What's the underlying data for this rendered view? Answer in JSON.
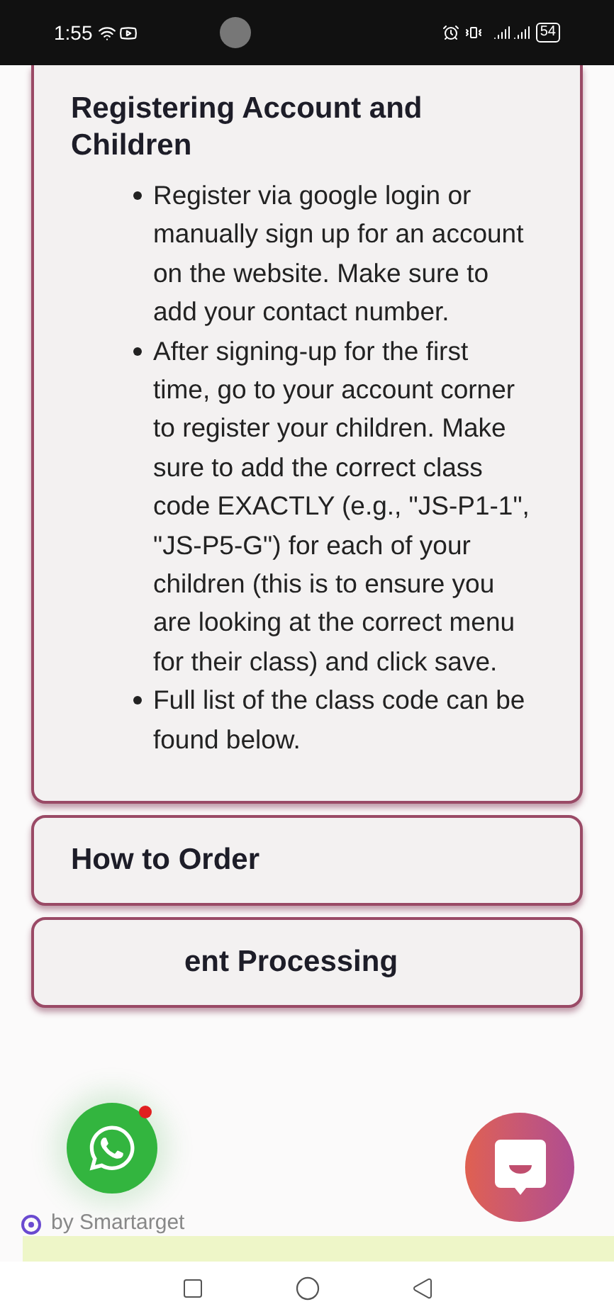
{
  "status_bar": {
    "time": "1:55",
    "battery": "54"
  },
  "sections": [
    {
      "title": "Registering Account and Children",
      "expanded": true,
      "bullets": [
        "Register via google login or manually sign up for an account on the website. Make sure to add your contact number.",
        "After signing-up for the first time, go to your account corner to register your children. Make sure to add the correct class code EXACTLY (e.g., \"JS-P1-1\", \"JS-P5-G\") for each of your children (this is to ensure you are looking at the correct menu for their class) and click save.",
        "Full list of the class code can be found below."
      ]
    },
    {
      "title": "How to Order",
      "expanded": false
    },
    {
      "title": "ent Processing",
      "expanded": false
    }
  ],
  "widget": {
    "credit": "by Smartarget",
    "notification": true
  }
}
